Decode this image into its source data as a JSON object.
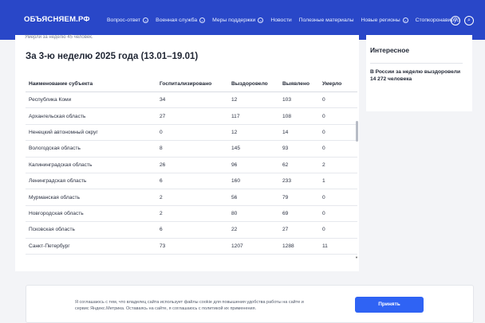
{
  "header": {
    "logo": "ОБЪЯСНЯЕМ.РФ",
    "nav": [
      {
        "label": "Вопрос-ответ",
        "dropdown": true
      },
      {
        "label": "Военная служба",
        "dropdown": true
      },
      {
        "label": "Меры поддержки",
        "dropdown": true
      },
      {
        "label": "Новости",
        "dropdown": false
      },
      {
        "label": "Полезные материалы",
        "dropdown": false
      },
      {
        "label": "Новые регионы",
        "dropdown": true
      },
      {
        "label": "Стопкоронавирус",
        "dropdown": false
      }
    ],
    "help_glyph": "?",
    "search_glyph": "⌕"
  },
  "main": {
    "prev_stat": "Умерли за неделю 45 человек.",
    "week_title": "За 3-ю неделю 2025 года (13.01–19.01)",
    "columns": [
      "Наименование субъекта",
      "Госпитализировано",
      "Выздоровело",
      "Выявлено",
      "Умерло"
    ],
    "rows": [
      [
        "Республика Коми",
        "34",
        "12",
        "103",
        "0"
      ],
      [
        "Архангельская область",
        "27",
        "117",
        "108",
        "0"
      ],
      [
        "Ненецкий автономный округ",
        "0",
        "12",
        "14",
        "0"
      ],
      [
        "Вологодская область",
        "8",
        "145",
        "93",
        "0"
      ],
      [
        "Калининградская область",
        "26",
        "96",
        "62",
        "2"
      ],
      [
        "Ленинградская область",
        "6",
        "160",
        "233",
        "1"
      ],
      [
        "Мурманская область",
        "2",
        "56",
        "79",
        "0"
      ],
      [
        "Новгородская область",
        "2",
        "80",
        "69",
        "0"
      ],
      [
        "Псковская область",
        "6",
        "22",
        "27",
        "0"
      ],
      [
        "Санкт-Петербург",
        "73",
        "1207",
        "1288",
        "11"
      ]
    ]
  },
  "aside": {
    "title": "Интересное",
    "news": "В России за неделю выздоровели 14 272 человека"
  },
  "cookie": {
    "text": "Я соглашаюсь с тем, что владелец сайта использует файлы cookie для повышения удобства работы на сайте и сервис Яндекс.Метрика. Оставаясь на сайте, я соглашаюсь с политикой их применения.",
    "button": "Принять"
  },
  "colors": {
    "header_bg": "#2947c8",
    "accept_button": "#2f63f4"
  }
}
